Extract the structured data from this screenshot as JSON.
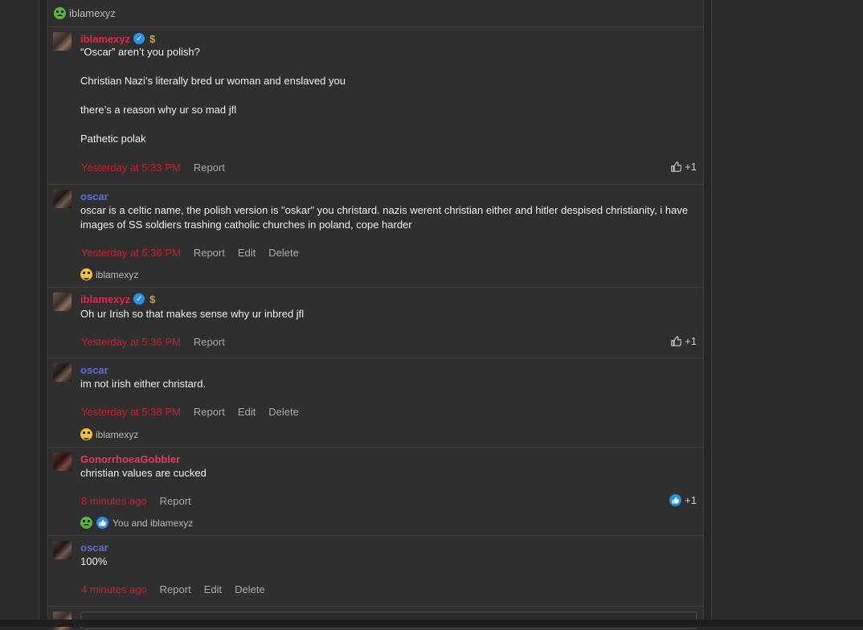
{
  "reaction_header": {
    "who": "iblamexyz"
  },
  "comments": [
    {
      "username": "iblamexyz",
      "lines": [
        "“Oscar” aren’t you polish?",
        "Christian Nazi’s literally bred ur woman and enslaved you",
        "there’s a reason why ur so mad jfl",
        "Pathetic polak"
      ],
      "timestamp": "Yesterday at 5:33 PM",
      "actions": [
        "Report"
      ],
      "like_count": "+1"
    },
    {
      "username": "oscar",
      "lines": [
        "oscar is a celtic name, the polish version is \"oskar\" you christard. nazis werent christian either and hitler despised christianity, i have images of SS soldiers trashing catholic churches in poland, cope harder"
      ],
      "timestamp": "Yesterday at 5:36 PM",
      "actions": [
        "Report",
        "Edit",
        "Delete"
      ],
      "reaction_who": "iblamexyz"
    },
    {
      "username": "iblamexyz",
      "lines": [
        "Oh ur Irish so that makes sense why ur inbred jfl"
      ],
      "timestamp": "Yesterday at 5:36 PM",
      "actions": [
        "Report"
      ],
      "like_count": "+1"
    },
    {
      "username": "oscar",
      "lines": [
        "im not irish either christard."
      ],
      "timestamp": "Yesterday at 5:38 PM",
      "actions": [
        "Report",
        "Edit",
        "Delete"
      ],
      "reaction_who": "iblamexyz"
    },
    {
      "username": "GonorrhoeaGobbler",
      "lines": [
        "christian values are cucked"
      ],
      "timestamp": "8 minutes ago",
      "actions": [
        "Report"
      ],
      "like_count": "+1",
      "reaction_who": "You and iblamexyz"
    },
    {
      "username": "oscar",
      "lines": [
        "100%"
      ],
      "timestamp": "4 minutes ago",
      "actions": [
        "Report",
        "Edit",
        "Delete"
      ]
    }
  ],
  "colors": {
    "timestamp": "#c8202c",
    "username_iblamexyz": "#e0284a",
    "username_oscar": "#5a6fd8",
    "username_gonorrhoea": "#e33a5d",
    "like_blue": "#2a8de8"
  },
  "icons": {
    "verified": "verified-badge-icon",
    "dollar": "dollar-icon",
    "thumb": "thumbs-up-icon",
    "emoji_green": "sick-emoji-icon",
    "emoji_yellow": "nerd-emoji-icon"
  }
}
